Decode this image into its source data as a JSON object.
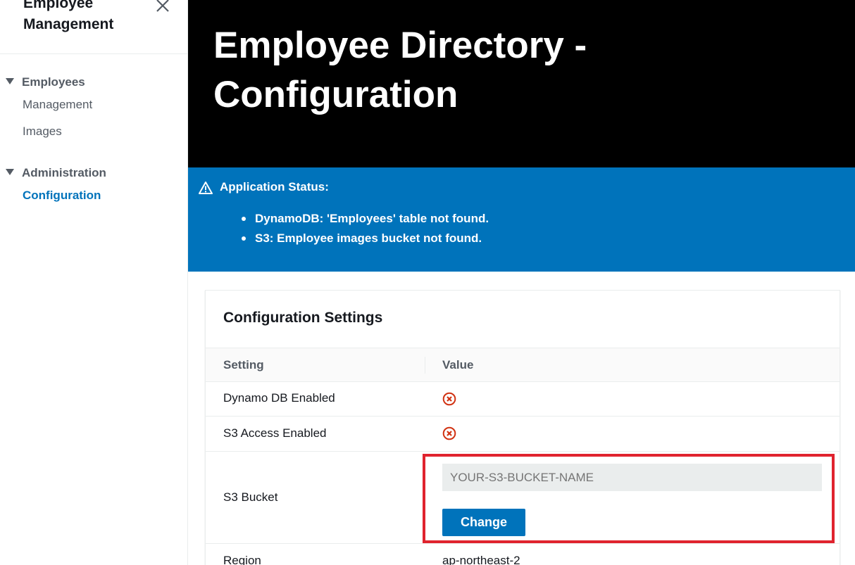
{
  "sidebar": {
    "app_title": "Employee Management",
    "sections": [
      {
        "title": "Employees",
        "items": [
          {
            "label": "Management"
          },
          {
            "label": "Images"
          }
        ]
      },
      {
        "title": "Administration",
        "items": [
          {
            "label": "Configuration",
            "active": true
          }
        ]
      }
    ]
  },
  "header": {
    "title": "Employee Directory - Configuration"
  },
  "flash": {
    "icon": "warning-icon",
    "title": "Application Status:",
    "messages": [
      "DynamoDB: 'Employees' table not found.",
      "S3: Employee images bucket not found."
    ]
  },
  "config_card": {
    "title": "Configuration Settings",
    "columns": [
      "Setting",
      "Value"
    ],
    "rows": [
      {
        "setting": "Dynamo DB Enabled",
        "value_icon": "error-x-icon",
        "status_color": "#d13212"
      },
      {
        "setting": "S3 Access Enabled",
        "value_icon": "error-x-icon",
        "status_color": "#d13212"
      },
      {
        "setting": "S3 Bucket",
        "input_placeholder": "YOUR-S3-BUCKET-NAME",
        "input_value": "",
        "button_label": "Change"
      },
      {
        "setting": "Region",
        "value": "ap-northeast-2"
      }
    ]
  },
  "colors": {
    "accent": "#0073bb",
    "header_bg": "#000000",
    "error": "#d13212",
    "highlight": "#e0232e"
  }
}
